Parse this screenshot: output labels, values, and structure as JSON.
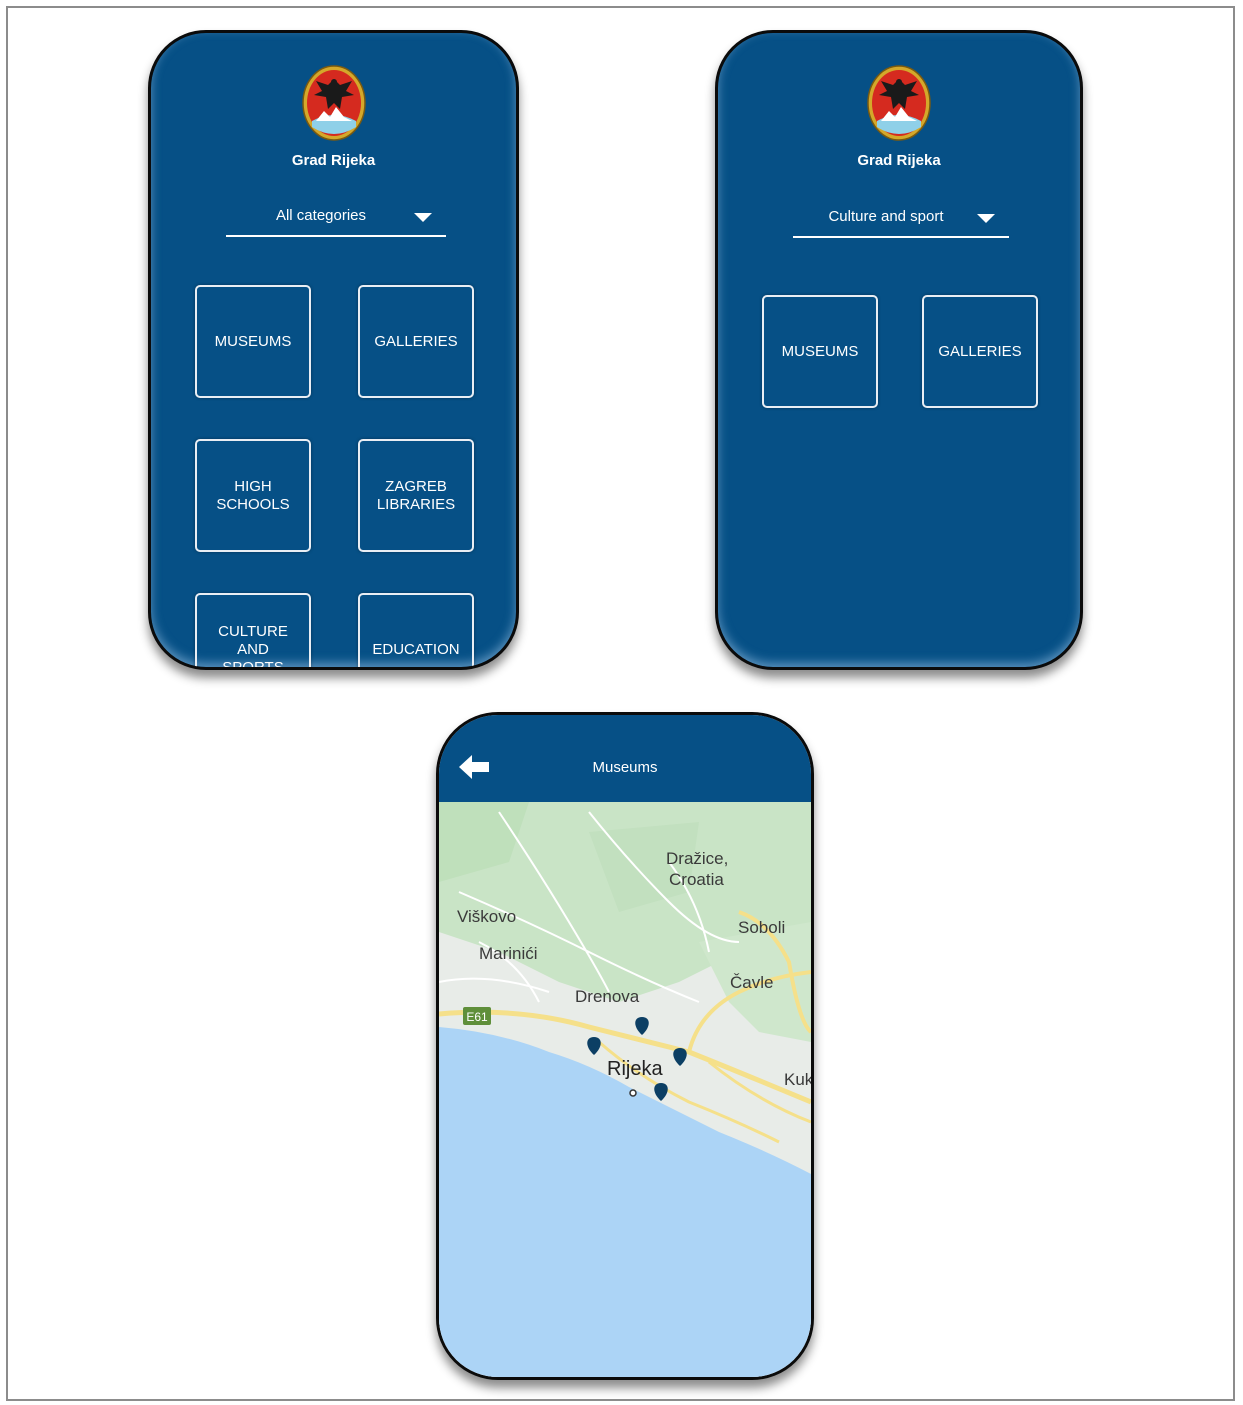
{
  "screens": [
    {
      "city_name": "Grad Rijeka",
      "dropdown": {
        "selected": "All categories"
      },
      "tiles": [
        "MUSEUMS",
        "GALLERIES",
        "HIGH SCHOOLS",
        "ZAGREB LIBRARIES",
        "CULTURE AND SPORTS",
        "EDUCATION"
      ]
    },
    {
      "city_name": "Grad Rijeka",
      "dropdown": {
        "selected": "Culture and sport"
      },
      "tiles": [
        "MUSEUMS",
        "GALLERIES"
      ]
    },
    {
      "header_title": "Museums",
      "map": {
        "places": [
          "Dražice,",
          "Croatia",
          "Viškovo",
          "Soboli",
          "Marinići",
          "Čavle",
          "Drenova",
          "Rijeka",
          "Kuk"
        ],
        "road_shield": "E61",
        "marker_count": 4
      }
    }
  ],
  "colors": {
    "brand_blue": "#065086",
    "sea": "#acd4f6",
    "land": "#e8ece8",
    "green": "#c9e4c6",
    "road": "#f5e08a"
  }
}
